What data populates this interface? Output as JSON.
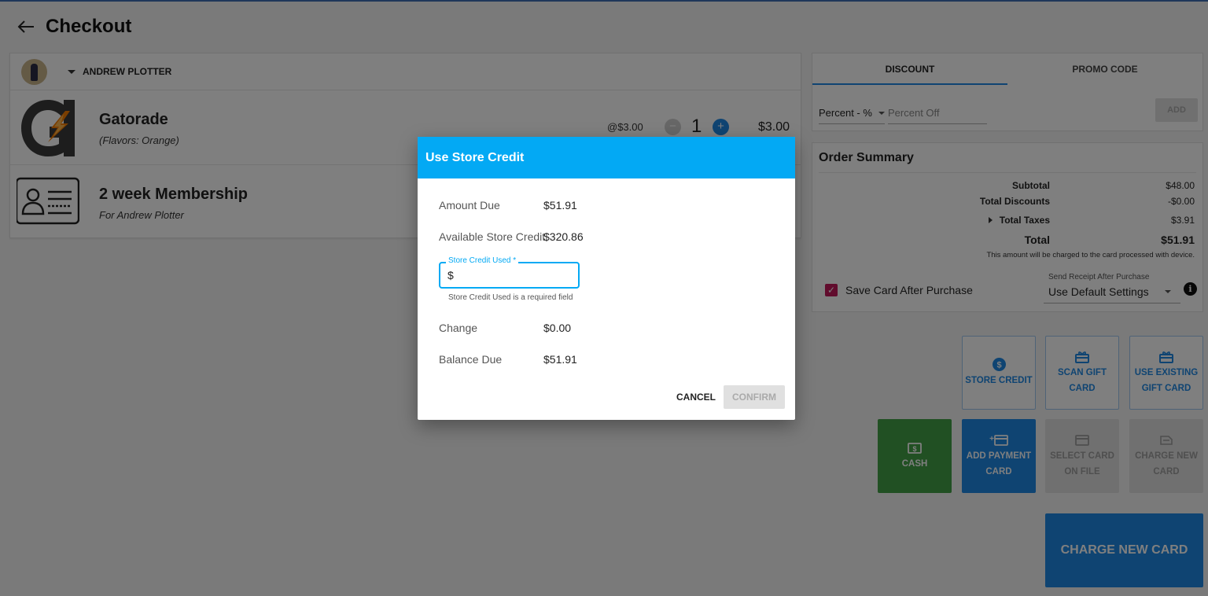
{
  "header": {
    "title": "Checkout",
    "back_icon": "arrow-left-icon"
  },
  "customer": {
    "name": "ANDREW PLOTTER"
  },
  "cart": {
    "items": [
      {
        "name": "Gatorade",
        "subtitle": "(Flavors: Orange)",
        "unit_price": "@$3.00",
        "minus": "−",
        "quantity": "1",
        "plus": "+",
        "total": "$3.00",
        "icon": "gatorade-logo-icon"
      },
      {
        "name": "2 week Membership",
        "subtitle": "For Andrew Plotter",
        "icon": "membership-card-icon"
      }
    ]
  },
  "discount": {
    "tabs": [
      {
        "label": "DISCOUNT",
        "active": true
      },
      {
        "label": "PROMO CODE",
        "active": false
      }
    ],
    "type_value": "Percent - %",
    "input_placeholder": "Percent Off",
    "add_label": "ADD"
  },
  "summary": {
    "title": "Order Summary",
    "subtotal_label": "Subtotal",
    "subtotal_value": "$48.00",
    "discounts_label": "Total Discounts",
    "discounts_value": "-$0.00",
    "taxes_label": "Total Taxes",
    "taxes_value": "$3.91",
    "total_label": "Total",
    "total_value": "$51.91",
    "note": "This amount will be charged to the card processed with device.",
    "save_card_label": "Save Card After Purchase",
    "save_card_checked": true,
    "receipt_label": "Send Receipt After Purchase",
    "receipt_value": "Use Default Settings",
    "info_glyph": "i"
  },
  "payment": {
    "store_credit": "STORE CREDIT",
    "scan_gift_1": "SCAN GIFT",
    "scan_gift_2": "CARD",
    "use_gift_1": "USE EXISTING",
    "use_gift_2": "GIFT CARD",
    "cash": "CASH",
    "add_card_1": "ADD PAYMENT",
    "add_card_2": "CARD",
    "select_card_1": "SELECT CARD",
    "select_card_2": "ON FILE",
    "charge_new_1": "CHARGE NEW",
    "charge_new_2": "CARD",
    "charge_big": "CHARGE NEW CARD"
  },
  "dialog": {
    "title": "Use Store Credit",
    "amount_due_label": "Amount Due",
    "amount_due_value": "$51.91",
    "available_label": "Available Store Credit",
    "available_value": "$320.86",
    "field_label": "Store Credit Used *",
    "field_prefix": "$",
    "field_value": "",
    "helper": "Store Credit Used is a required field",
    "change_label": "Change",
    "change_value": "$0.00",
    "balance_label": "Balance Due",
    "balance_value": "$51.91",
    "cancel_label": "CANCEL",
    "confirm_label": "CONFIRM"
  },
  "colors": {
    "accent": "#1e88e5",
    "dialog_header": "#03a9f4",
    "cash": "#43a047",
    "checkbox": "#c2185b"
  }
}
